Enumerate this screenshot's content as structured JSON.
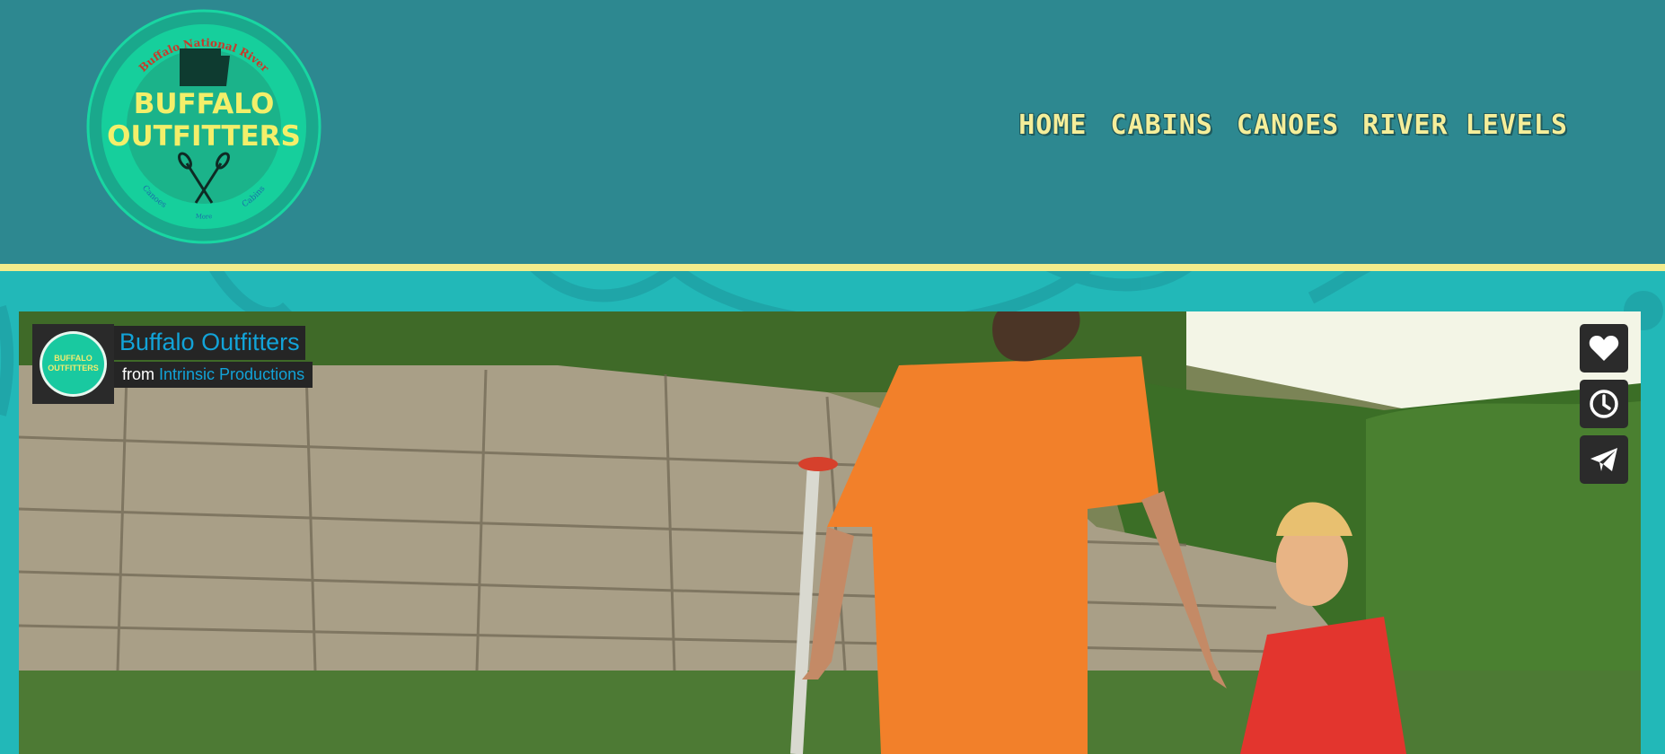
{
  "site": {
    "logo": {
      "top_arc_text": "Buffalo National River",
      "name_line1": "BUFFALO",
      "name_line2": "OUTFITTERS",
      "bottom_arc_left": "Canoes",
      "bottom_arc_center": "More",
      "bottom_arc_right": "Cabins"
    },
    "nav": [
      {
        "label": "HOME"
      },
      {
        "label": "CABINS"
      },
      {
        "label": "CANOES"
      },
      {
        "label": "RIVER LEVELS"
      }
    ]
  },
  "video": {
    "title": "Buffalo Outfitters",
    "from_prefix": "from",
    "author": "Intrinsic Productions",
    "portrait_text_line1": "BUFFALO",
    "portrait_text_line2": "OUTFITTERS",
    "actions": [
      {
        "icon": "heart-icon"
      },
      {
        "icon": "clock-icon"
      },
      {
        "icon": "paper-plane-icon"
      }
    ]
  },
  "colors": {
    "header_bg": "#2d8890",
    "stripe": "#f3ec8c",
    "page_bg": "#22b8b8",
    "nav_text": "#f5ee9a",
    "link_blue": "#12a3d8"
  }
}
